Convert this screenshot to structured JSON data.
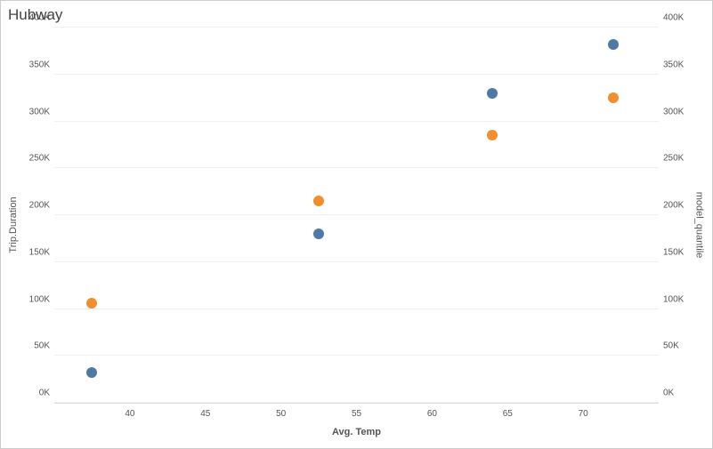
{
  "title": "Hubway",
  "xlabel": "Avg. Temp",
  "ylabel_left": "Trip.Duration",
  "ylabel_right": "model_quantile",
  "chart_data": {
    "type": "scatter",
    "title": "Hubway",
    "xlabel": "Avg. Temp",
    "ylabel": "Trip.Duration",
    "ylabel2": "model_quantile",
    "xlim": [
      35,
      75
    ],
    "ylim": [
      0,
      400000
    ],
    "ylim2": [
      0,
      400000
    ],
    "x_ticks": [
      40,
      45,
      50,
      55,
      60,
      65,
      70
    ],
    "y_ticks": [
      0,
      50000,
      100000,
      150000,
      200000,
      250000,
      300000,
      350000,
      400000
    ],
    "y_tick_labels": [
      "0K",
      "50K",
      "100K",
      "150K",
      "200K",
      "250K",
      "300K",
      "350K",
      "400K"
    ],
    "series": [
      {
        "name": "Trip.Duration",
        "color": "#4e79a7",
        "points": [
          {
            "x": 37.5,
            "y": 32000
          },
          {
            "x": 52.5,
            "y": 180000
          },
          {
            "x": 64.0,
            "y": 330000
          },
          {
            "x": 72.0,
            "y": 382000
          }
        ]
      },
      {
        "name": "model_quantile",
        "color": "#f28e2b",
        "points": [
          {
            "x": 37.5,
            "y": 106000
          },
          {
            "x": 52.5,
            "y": 215000
          },
          {
            "x": 64.0,
            "y": 285000
          },
          {
            "x": 72.0,
            "y": 325000
          }
        ]
      }
    ]
  }
}
